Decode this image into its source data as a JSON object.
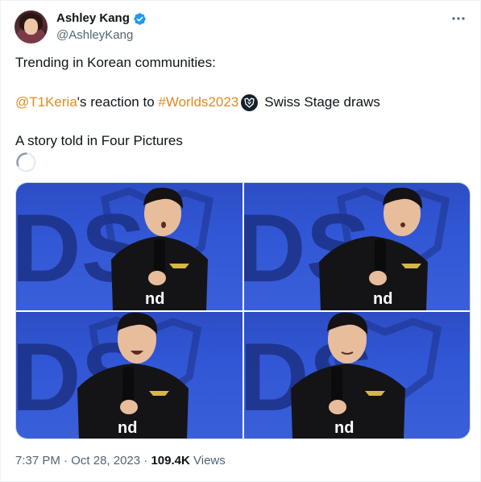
{
  "author": {
    "display_name": "Ashley Kang",
    "handle": "@AshleyKang",
    "verified": true,
    "verified_color": "#1d9bf0"
  },
  "tweet": {
    "line1": "Trending in Korean communities:",
    "mention": "@T1Keria",
    "reaction_text": "'s reaction to ",
    "hashtag": "#Worlds2023",
    "line2_tail": "Swiss Stage draws",
    "line3": "A story told in Four Pictures",
    "link_color": "#e08a1e"
  },
  "media": {
    "count": 4,
    "jersey_text": "nd"
  },
  "footer": {
    "time": "7:37 PM",
    "date": "Oct 28, 2023",
    "separator": " · ",
    "views_count": "109.4K",
    "views_label": " Views"
  }
}
